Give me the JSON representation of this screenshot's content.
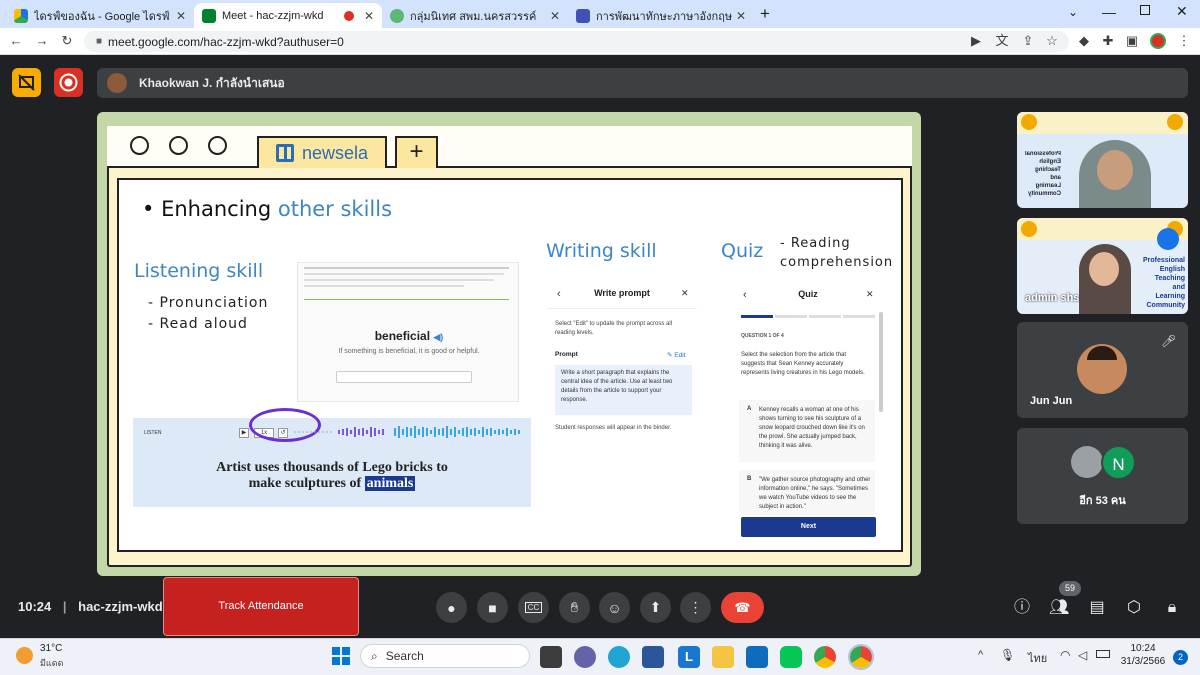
{
  "browser": {
    "tabs": [
      {
        "title": "ไดรฟ์ของฉัน - Google ไดรฟ์",
        "active": false
      },
      {
        "title": "Meet - hac-zzjm-wkd",
        "active": true
      },
      {
        "title": "กลุ่มนิเทศ สพม.นครสวรรค์",
        "active": false
      },
      {
        "title": "การพัฒนาทักษะภาษาอังกฤษ English",
        "active": false
      }
    ],
    "new_tab": "+",
    "url": "meet.google.com/hac-zzjm-wkd?authuser=0"
  },
  "meet": {
    "presenter_text": "Khaokwan J. กำลังนำเสนอ",
    "time": "10:24",
    "meeting_code": "hac-zzjm-wkd",
    "attendance_button": "Track Attendance",
    "people_badge": "59",
    "tiles": [
      {
        "name": "",
        "caption_lines": [
          "Professional",
          "English",
          "Teaching",
          "and",
          "Learning",
          "Community"
        ]
      },
      {
        "name": "admin shs",
        "caption_lines": [
          "Professional",
          "English",
          "Teaching",
          "and",
          "Learning",
          "Community"
        ]
      },
      {
        "name": "Jun Jun",
        "muted": true
      },
      {
        "name": "อีก 53 คน",
        "avatar_letter": "N"
      }
    ]
  },
  "slide": {
    "tab_label": "newsela",
    "heading_part1": "Enhancing",
    "heading_part2": "other skills",
    "listening": {
      "title": "Listening skill",
      "items": [
        "- Pronunciation",
        "- Read aloud"
      ],
      "word": "beneficial",
      "definition": "If something is beneficial, it is good or helpful.",
      "listen_label": "LISTEN",
      "speed": "1x",
      "sentence_a": "Artist uses thousands of Lego bricks to",
      "sentence_b": "make sculptures of",
      "sentence_highlight": "animals"
    },
    "writing": {
      "title": "Writing skill",
      "panel_title": "Write prompt",
      "intro": "Select \"Edit\" to update the prompt across all reading levels.",
      "prompt_label": "Prompt",
      "edit_label": "Edit",
      "prompt_text": "Write a short paragraph that explains the central idea of the article. Use at least two details from the article to support your response.",
      "footer": "Student responses will appear in the binder."
    },
    "quiz": {
      "title": "Quiz",
      "subtitle_1": "- Reading",
      "subtitle_2": "comprehension",
      "panel_title": "Quiz",
      "question_num": "QUESTION 1 OF 4",
      "question": "Select the selection from the article that suggests that Sean Kenney accurately represents living creatures in his Lego models.",
      "options": [
        {
          "letter": "A",
          "text": "Kenney recalls a woman at one of his shows turning to see his sculpture of a snow leopard crouched down like it's on the prowl. She actually jumped back, thinking it was alive."
        },
        {
          "letter": "B",
          "text": "\"We gather source photography and other information online,\" he says. \"Sometimes we watch YouTube videos to see the subject in action.\""
        }
      ],
      "next_button": "Next"
    }
  },
  "taskbar": {
    "weather_temp": "31°C",
    "weather_desc": "มีแดด",
    "search": "Search",
    "lang": "ไทย",
    "clock_time": "10:24",
    "clock_date": "31/3/2566",
    "notif": "2"
  }
}
